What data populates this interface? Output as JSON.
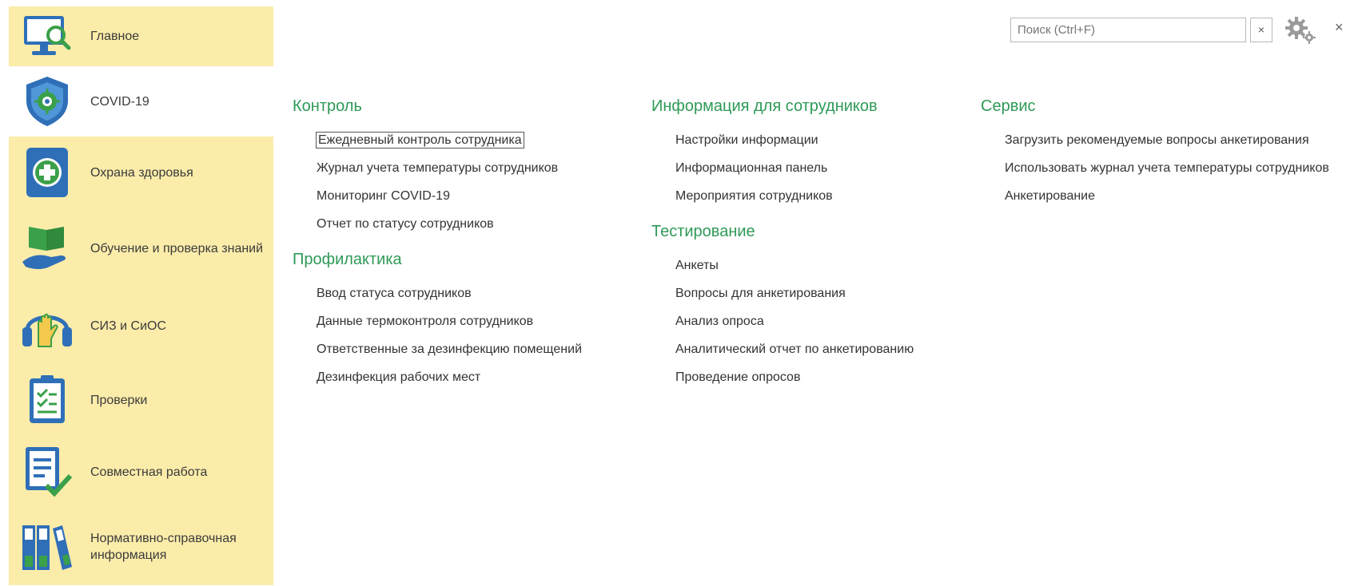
{
  "sidebar": {
    "items": [
      {
        "label": "Главное",
        "icon": "monitor-search-icon"
      },
      {
        "label": "COVID-19",
        "icon": "shield-virus-icon"
      },
      {
        "label": "Охрана здоровья",
        "icon": "medical-plus-icon"
      },
      {
        "label": "Обучение и проверка знаний",
        "icon": "book-hand-icon"
      },
      {
        "label": "СИЗ и СиОС",
        "icon": "headphones-glove-icon"
      },
      {
        "label": "Проверки",
        "icon": "checklist-clipboard-icon"
      },
      {
        "label": "Совместная работа",
        "icon": "document-check-icon"
      },
      {
        "label": "Нормативно-справочная информация",
        "icon": "binders-icon"
      }
    ]
  },
  "search": {
    "placeholder": "Поиск (Ctrl+F)",
    "clear": "×"
  },
  "window": {
    "close": "×"
  },
  "columns": [
    {
      "sections": [
        {
          "title": "Контроль",
          "links": [
            "Ежедневный контроль сотрудника",
            "Журнал учета температуры сотрудников",
            "Мониторинг COVID-19",
            "Отчет по статусу сотрудников"
          ]
        },
        {
          "title": "Профилактика",
          "links": [
            "Ввод статуса сотрудников",
            "Данные термоконтроля сотрудников",
            "Ответственные за дезинфекцию помещений",
            "Дезинфекция рабочих мест"
          ]
        }
      ]
    },
    {
      "sections": [
        {
          "title": "Информация для сотрудников",
          "links": [
            "Настройки информации",
            "Информационная панель",
            "Мероприятия сотрудников"
          ]
        },
        {
          "title": "Тестирование",
          "links": [
            "Анкеты",
            "Вопросы для анкетирования",
            "Анализ опроса",
            "Аналитический отчет по анкетированию",
            "Проведение опросов"
          ]
        }
      ]
    },
    {
      "sections": [
        {
          "title": "Сервис",
          "links": [
            "Загрузить рекомендуемые вопросы анкетирования",
            "Использовать журнал учета температуры сотрудников",
            "Анкетирование"
          ]
        }
      ]
    }
  ],
  "colors": {
    "sidebar_bg": "#fbecaa",
    "section_title": "#2e9a57",
    "icon_blue": "#2f6fb8"
  }
}
